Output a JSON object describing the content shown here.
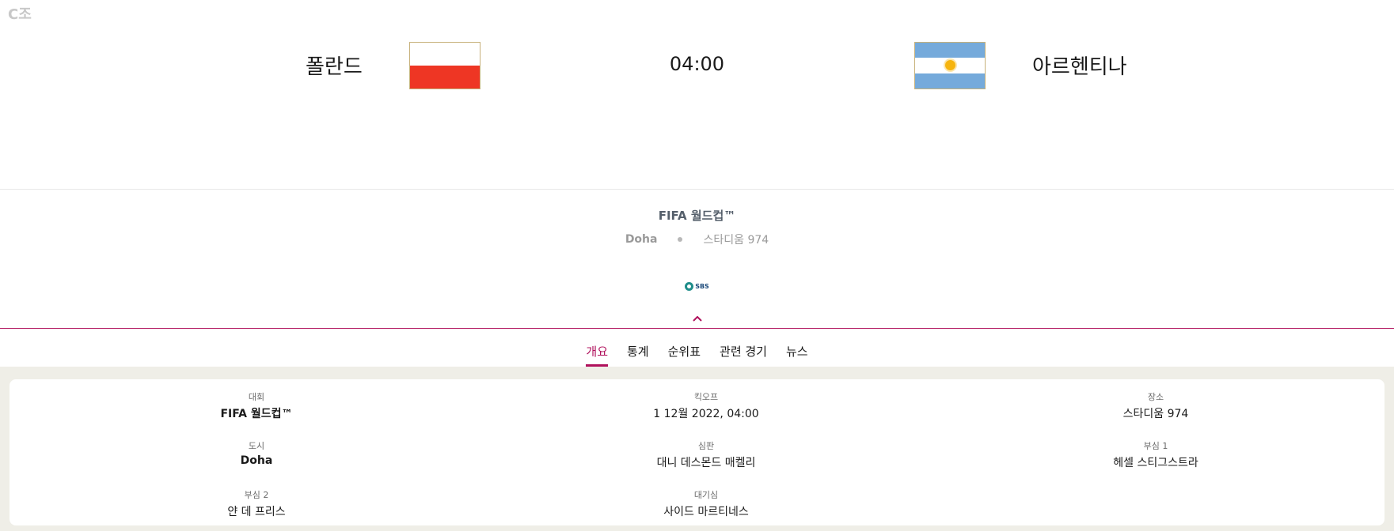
{
  "group_label": "C조",
  "match": {
    "home_team": "폴란드",
    "away_team": "아르헨티나",
    "kickoff_time": "04:00",
    "home_flag": "poland-flag",
    "away_flag": "argentina-flag"
  },
  "competition": {
    "name": "FIFA 월드컵™",
    "city": "Doha",
    "stadium": "스타디움 974"
  },
  "broadcaster": {
    "name": "SBS"
  },
  "tabs": [
    {
      "label": "개요",
      "active": true
    },
    {
      "label": "통계",
      "active": false
    },
    {
      "label": "순위표",
      "active": false
    },
    {
      "label": "관련 경기",
      "active": false
    },
    {
      "label": "뉴스",
      "active": false
    }
  ],
  "details": {
    "competition": {
      "label": "대회",
      "value": "FIFA 월드컵™"
    },
    "kickoff": {
      "label": "킥오프",
      "value": "1 12월 2022, 04:00"
    },
    "venue": {
      "label": "장소",
      "value": "스타디움 974"
    },
    "city": {
      "label": "도시",
      "value": "Doha"
    },
    "referee": {
      "label": "심판",
      "value": "대니 데스몬드 매켈리"
    },
    "assistant1": {
      "label": "부심 1",
      "value": "헤셀 스티그스트라"
    },
    "assistant2": {
      "label": "부심 2",
      "value": "얀 데 프리스"
    },
    "fourth_official": {
      "label": "대기심",
      "value": "사이드 마르티네스"
    }
  },
  "colors": {
    "accent": "#b0115c",
    "poland_red": "#ee3624",
    "argentina_blue": "#75aadb",
    "panel_bg": "#efeee7"
  }
}
